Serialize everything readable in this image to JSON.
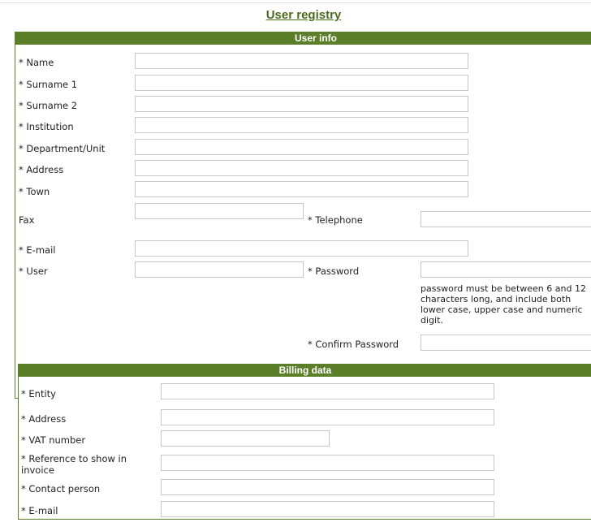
{
  "page": {
    "title": "User registry"
  },
  "user_info": {
    "header": "User info",
    "name_label": "* Name",
    "surname1_label": "* Surname 1",
    "surname2_label": "* Surname 2",
    "institution_label": "* Institution",
    "department_label": "* Department/Unit",
    "address_label": "* Address",
    "town_label": "* Town",
    "fax_label": "Fax",
    "telephone_label": "* Telephone",
    "email_label": "* E-mail",
    "user_label": "* User",
    "password_label": "* Password",
    "password_hint": "password must be between 6 and 12 characters long, and include both lower case, upper case and numeric digit.",
    "confirm_password_label": "* Confirm Password"
  },
  "billing": {
    "header": "Billing data",
    "entity_label": "* Entity",
    "address_label": "* Address",
    "vat_label": "* VAT number",
    "reference_label": "* Reference to show in invoice",
    "contact_label": "* Contact person",
    "email_label": "* E-mail"
  },
  "colors": {
    "accent": "#5b7f28",
    "title": "#4b6b1b",
    "field_border": "#c8c8c8"
  }
}
